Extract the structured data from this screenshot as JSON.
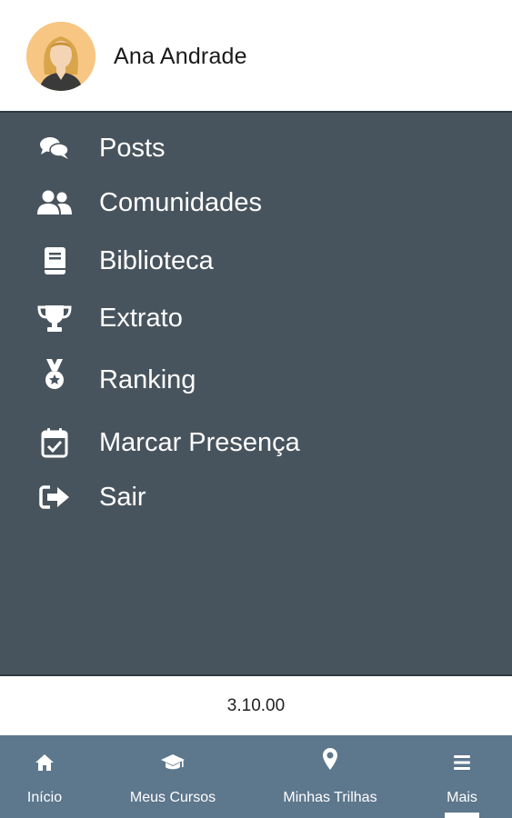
{
  "user": {
    "name": "Ana Andrade"
  },
  "menu": {
    "items": [
      {
        "label": "Posts",
        "icon": "comments-icon"
      },
      {
        "label": "Comunidades",
        "icon": "users-icon"
      },
      {
        "label": "Biblioteca",
        "icon": "book-icon"
      },
      {
        "label": "Extrato",
        "icon": "trophy-icon"
      },
      {
        "label": "Ranking",
        "icon": "medal-icon"
      },
      {
        "label": "Marcar Presença",
        "icon": "calendar-check-icon"
      },
      {
        "label": "Sair",
        "icon": "sign-out-icon"
      }
    ]
  },
  "version": "3.10.00",
  "bottom_nav": {
    "items": [
      {
        "label": "Início",
        "icon": "home-icon"
      },
      {
        "label": "Meus Cursos",
        "icon": "graduation-cap-icon"
      },
      {
        "label": "Minhas Trilhas",
        "icon": "map-marker-icon"
      },
      {
        "label": "Mais",
        "icon": "menu-icon",
        "active": true
      }
    ]
  },
  "colors": {
    "menu_bg": "#48545d",
    "bottom_nav_bg": "#5d778c",
    "avatar_bg": "#f7c682"
  }
}
